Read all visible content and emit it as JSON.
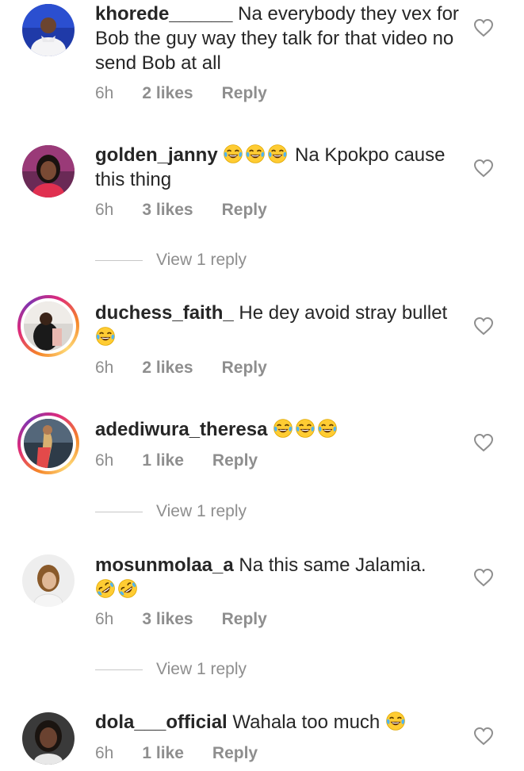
{
  "comments": [
    {
      "username": "khorede______",
      "text": " Na everybody they vex for Bob  the guy way they talk for that video no send Bob at all",
      "time": "6h",
      "likes": "2 likes",
      "reply": "Reply",
      "emoji": [],
      "view_replies": ""
    },
    {
      "username": "golden_janny",
      "text": " Na Kpokpo cause this thing",
      "time": "6h",
      "likes": "3 likes",
      "reply": "Reply",
      "emoji": [
        "face-with-tears-of-joy",
        "face-with-tears-of-joy",
        "face-with-tears-of-joy"
      ],
      "view_replies": "View 1 reply"
    },
    {
      "username": "duchess_faith_",
      "text": " He dey avoid stray bullet",
      "time": "6h",
      "likes": "2 likes",
      "reply": "Reply",
      "emoji": [
        "face-with-tears-of-joy"
      ],
      "view_replies": ""
    },
    {
      "username": "adediwura_theresa",
      "text": "",
      "time": "6h",
      "likes": "1 like",
      "reply": "Reply",
      "emoji": [
        "face-with-tears-of-joy",
        "face-with-tears-of-joy",
        "face-with-tears-of-joy"
      ],
      "view_replies": "View 1 reply"
    },
    {
      "username": "mosunmolaa_a",
      "text": " Na this same Jalamia.",
      "time": "6h",
      "likes": "3 likes",
      "reply": "Reply",
      "emoji": [
        "rolling-on-floor-laughing",
        "rolling-on-floor-laughing"
      ],
      "view_replies": "View 1 reply"
    },
    {
      "username": "dola___official",
      "text": " Wahala too much",
      "time": "6h",
      "likes": "1 like",
      "reply": "Reply",
      "emoji": [
        "face-with-tears-of-joy"
      ],
      "view_replies": ""
    }
  ],
  "colors": {
    "text": "#262626",
    "secondary": "#8e8e8e",
    "story_ring_start": "#f58529",
    "story_ring_mid": "#dd2a7b"
  },
  "icons": {
    "like": "heart-outline-icon"
  }
}
